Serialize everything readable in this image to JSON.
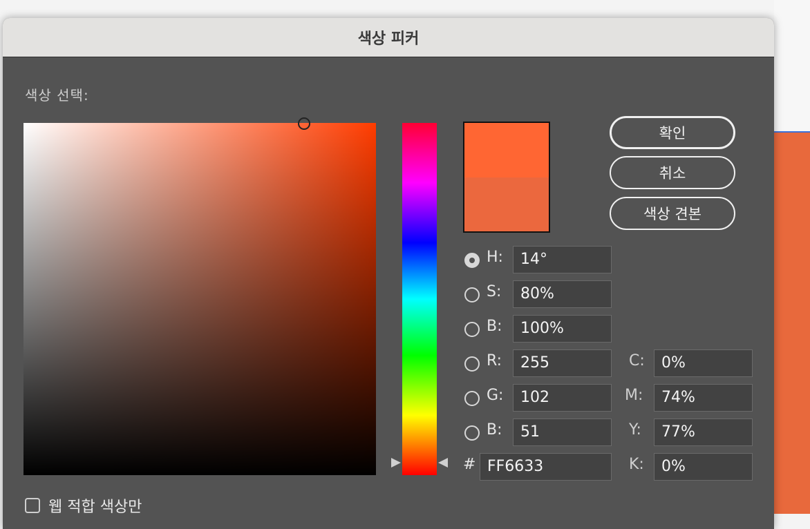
{
  "window": {
    "title": "색상 피커"
  },
  "picker": {
    "select_label": "색상 선택:",
    "current_color": "#FF6633",
    "original_color": "#EB683E",
    "hue_base_color": "#FF3C00"
  },
  "buttons": {
    "ok": "확인",
    "cancel": "취소",
    "swatches": "색상 견본"
  },
  "hsb": {
    "h": {
      "label": "H:",
      "value": "14°"
    },
    "s": {
      "label": "S:",
      "value": "80%"
    },
    "b": {
      "label": "B:",
      "value": "100%"
    }
  },
  "rgb": {
    "r": {
      "label": "R:",
      "value": "255"
    },
    "g": {
      "label": "G:",
      "value": "102"
    },
    "b": {
      "label": "B:",
      "value": "51"
    }
  },
  "hex": {
    "label": "#",
    "value": "FF6633"
  },
  "cmyk": {
    "c": {
      "label": "C:",
      "value": "0%"
    },
    "m": {
      "label": "M:",
      "value": "74%"
    },
    "y": {
      "label": "Y:",
      "value": "77%"
    },
    "k": {
      "label": "K:",
      "value": "0%"
    }
  },
  "web_only": {
    "label": "웹 적합 색상만",
    "checked": false
  },
  "selected_mode": "H"
}
